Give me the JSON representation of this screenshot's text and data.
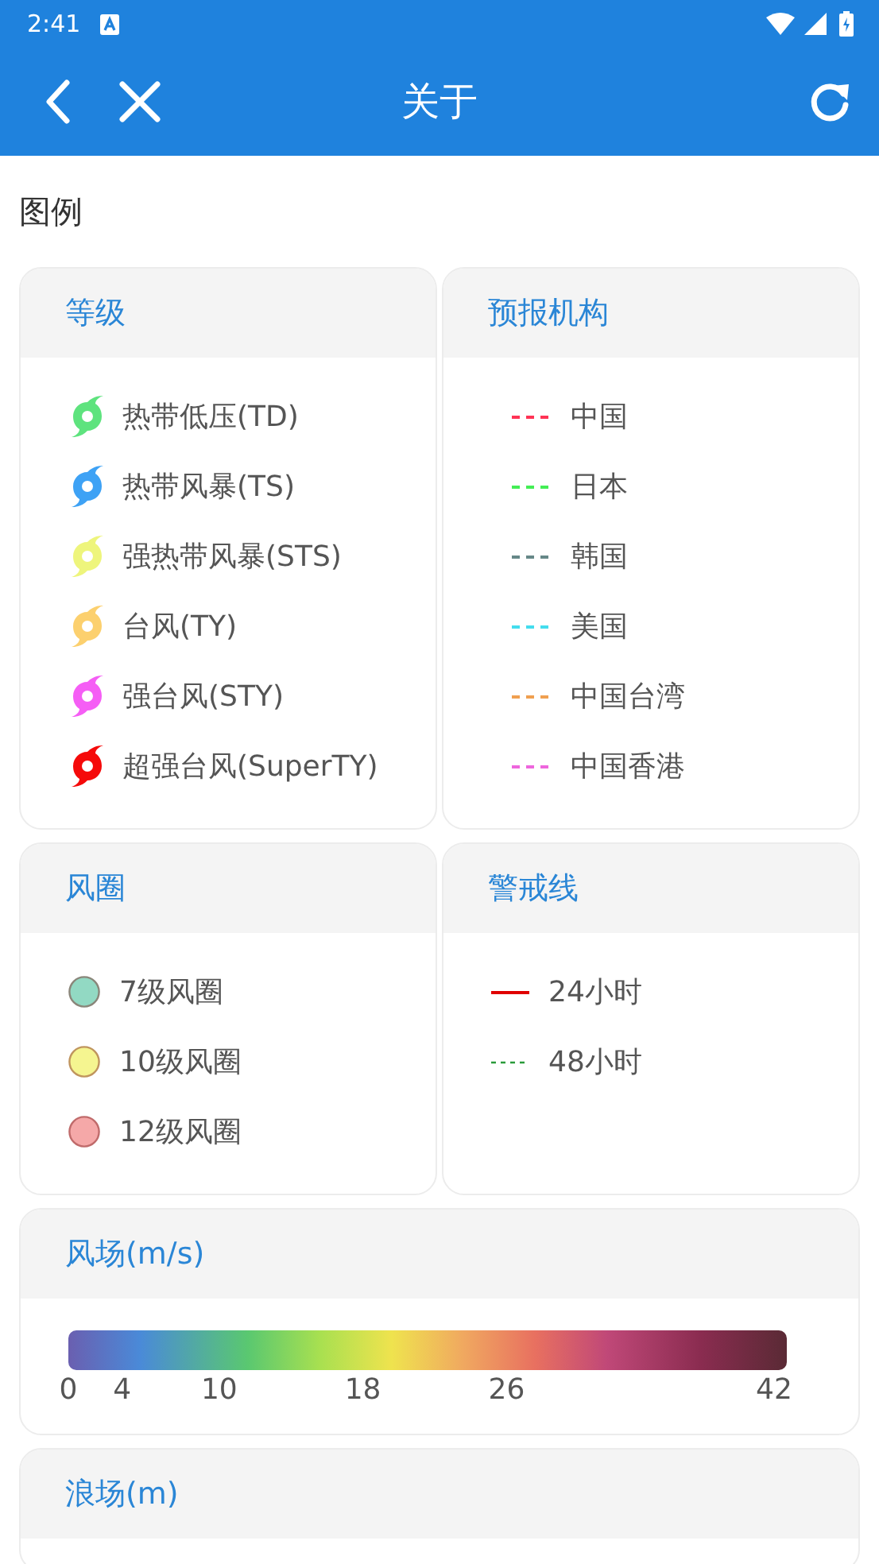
{
  "status_bar": {
    "time": "2:41"
  },
  "app_bar": {
    "title": "关于"
  },
  "section_title": "图例",
  "cards": [
    {
      "kind": "levels",
      "title": "等级",
      "items": [
        {
          "label": "热带低压(TD)",
          "color": "#5ee37e"
        },
        {
          "label": "热带风暴(TS)",
          "color": "#3ea2f5"
        },
        {
          "label": "强热带风暴(STS)",
          "color": "#eef57c"
        },
        {
          "label": "台风(TY)",
          "color": "#fcd06e"
        },
        {
          "label": "强台风(STY)",
          "color": "#f55ef5"
        },
        {
          "label": "超强台风(SuperTY)",
          "color": "#f50a0a"
        }
      ]
    },
    {
      "kind": "agencies",
      "title": "预报机构",
      "items": [
        {
          "label": "中国",
          "color": "#ff3355"
        },
        {
          "label": "日本",
          "color": "#44ee55"
        },
        {
          "label": "韩国",
          "color": "#668888"
        },
        {
          "label": "美国",
          "color": "#44ddee"
        },
        {
          "label": "中国台湾",
          "color": "#f0a050"
        },
        {
          "label": "中国香港",
          "color": "#ee66dd"
        }
      ]
    },
    {
      "kind": "wind_circles",
      "title": "风圈",
      "items": [
        {
          "label": "7级风圈",
          "color": "#92d9c3"
        },
        {
          "label": "10级风圈",
          "color": "#f5f590"
        },
        {
          "label": "12级风圈",
          "color": "#f5a8a8"
        }
      ]
    },
    {
      "kind": "warning_lines",
      "title": "警戒线",
      "items": [
        {
          "label": "24小时",
          "color": "#e00000",
          "kind": "solid"
        },
        {
          "label": "48小时",
          "color": "#2a9a3a",
          "kind": "dashed"
        }
      ]
    },
    {
      "kind": "wind_field",
      "title": "风场(m/s)",
      "ticks": [
        "0",
        "4",
        "10",
        "18",
        "26",
        "42"
      ]
    },
    {
      "kind": "wave_field",
      "title": "浪场(m)"
    }
  ]
}
